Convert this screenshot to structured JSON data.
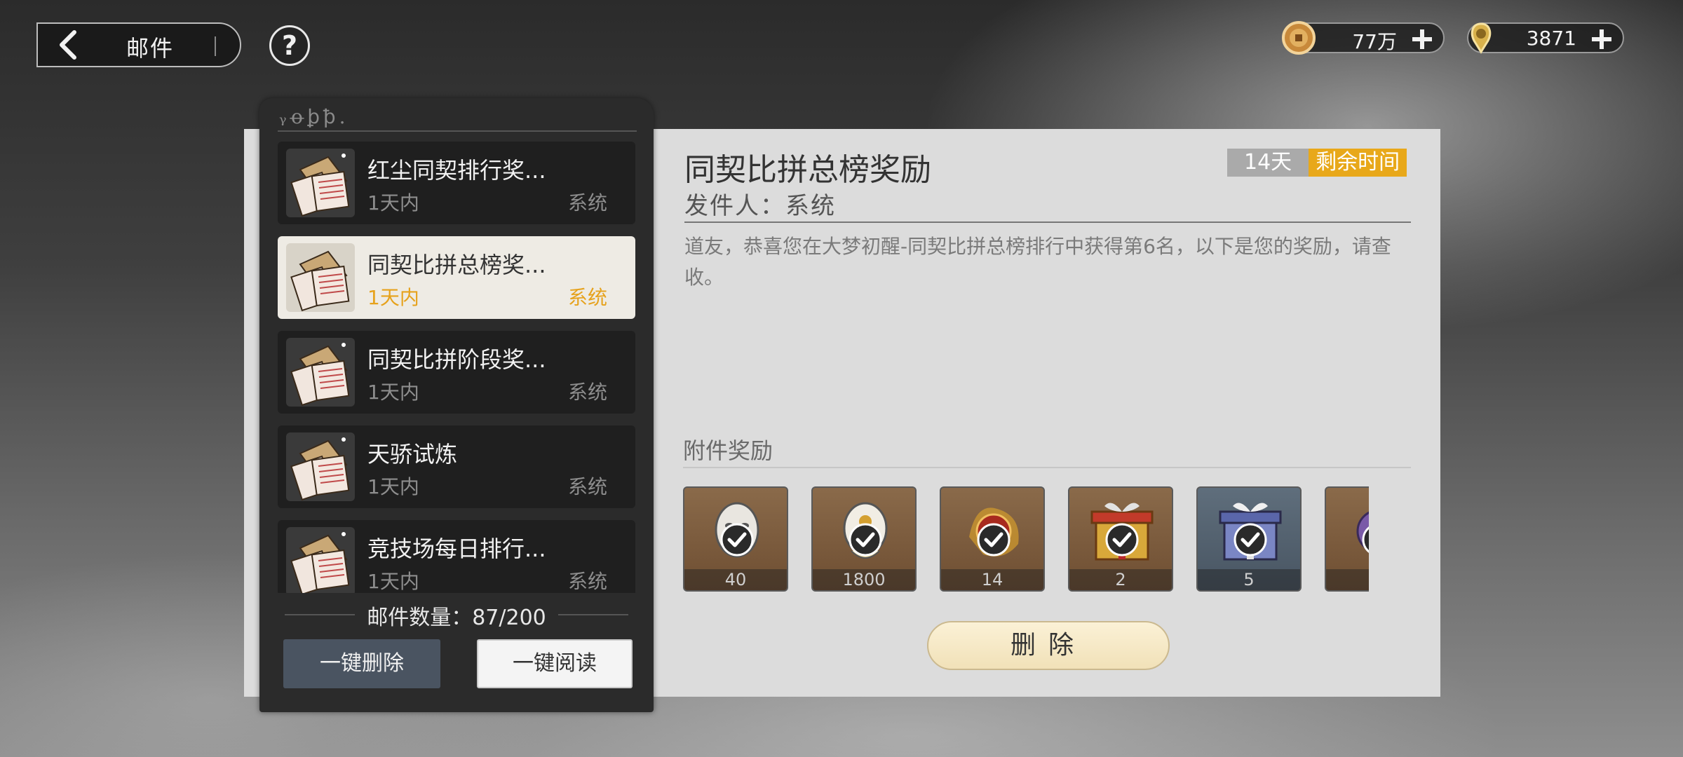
{
  "header": {
    "back_title": "邮件",
    "help_symbol": "?"
  },
  "currencies": [
    {
      "icon": "copper-coin-icon",
      "value": "77万"
    },
    {
      "icon": "gold-ingot-icon",
      "value": "3871"
    }
  ],
  "mail_list": {
    "items": [
      {
        "title": "红尘同契排行奖...",
        "time": "1天内",
        "sender": "系统",
        "selected": false
      },
      {
        "title": "同契比拼总榜奖...",
        "time": "1天内",
        "sender": "系统",
        "selected": true
      },
      {
        "title": "同契比拼阶段奖...",
        "time": "1天内",
        "sender": "系统",
        "selected": false
      },
      {
        "title": "天骄试炼",
        "time": "1天内",
        "sender": "系统",
        "selected": false
      },
      {
        "title": "竞技场每日排行...",
        "time": "1天内",
        "sender": "系统",
        "selected": false
      }
    ],
    "count_text": "邮件数量：87/200",
    "delete_all_label": "一键删除",
    "read_all_label": "一键阅读"
  },
  "detail": {
    "title": "同契比拼总榜奖励",
    "expire_days": "14天",
    "expire_label": "剩余时间",
    "sender_line": "发件人：系统",
    "body": "道友，恭喜您在大梦初醒-同契比拼总榜排行中获得第6名，以下是您的奖励，请查收。",
    "attachments_title": "附件奖励",
    "attachments": [
      {
        "icon": "white-mask-icon",
        "count": "40",
        "claimed": true
      },
      {
        "icon": "gold-mask-icon",
        "count": "1800",
        "claimed": true
      },
      {
        "icon": "flame-orb-icon",
        "count": "14",
        "claimed": true
      },
      {
        "icon": "gift-box-red-icon",
        "count": "2",
        "claimed": true
      },
      {
        "icon": "gift-box-blue-icon",
        "count": "5",
        "claimed": true
      },
      {
        "icon": "purple-item-icon",
        "count": "",
        "claimed": true
      }
    ],
    "delete_label": "删除"
  },
  "colors": {
    "accent_gold": "#e8a81a",
    "selected_bg": "#eeebe4",
    "panel_dark": "#2b2b2b",
    "panel_light": "#dcdcdc"
  }
}
